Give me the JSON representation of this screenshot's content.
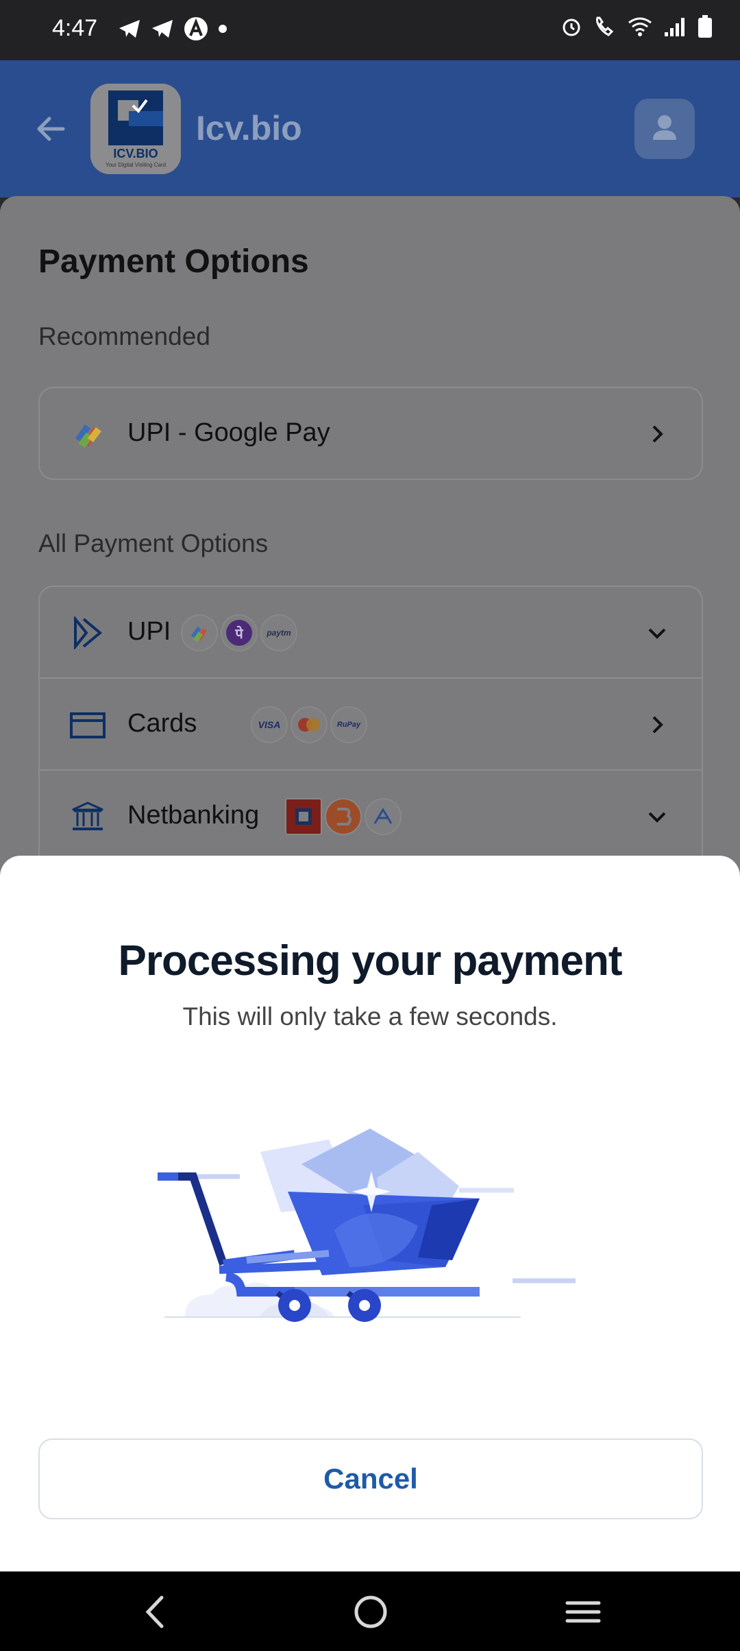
{
  "status_bar": {
    "time": "4:47",
    "left_icons": [
      "telegram-icon",
      "telegram-icon",
      "astro-icon",
      "dot-icon"
    ],
    "right_icons": [
      "alarm-icon",
      "wifi-call-icon",
      "wifi-icon",
      "signal-icon",
      "battery-icon"
    ]
  },
  "header": {
    "merchant_name": "Icv.bio",
    "logo_text": "ICV.BIO",
    "logo_subtext": "Your Digital Visiting Card"
  },
  "payment": {
    "title": "Payment Options",
    "recommended_label": "Recommended",
    "recommended_option": "UPI - Google Pay",
    "all_label": "All Payment Options",
    "options": [
      {
        "label": "UPI",
        "logos": [
          "gpay",
          "phonepe",
          "paytm"
        ]
      },
      {
        "label": "Cards",
        "logos": [
          "VISA",
          "mastercard",
          "RuPay"
        ]
      },
      {
        "label": "Netbanking",
        "logos": [
          "hdfc",
          "bob",
          "axis"
        ]
      }
    ],
    "paytm_text": "paytm",
    "visa_text": "VISA",
    "rupay_text": "RuPay",
    "phonepe_text": "पे"
  },
  "modal": {
    "title": "Processing your payment",
    "subtitle": "This will only take a few seconds.",
    "cancel_label": "Cancel"
  },
  "colors": {
    "header_bg": "#2a4d8f",
    "accent_blue": "#1f5aa8",
    "cart_blue": "#3b5fe0"
  }
}
